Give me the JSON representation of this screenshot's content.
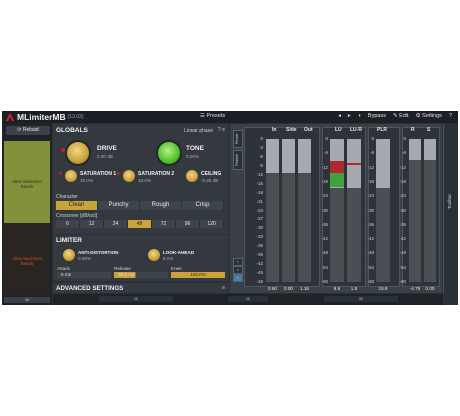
{
  "app": {
    "name": "MLimiterMB",
    "version": "(13.03)",
    "presets_label": "Presets",
    "bypass_label": "Bypass",
    "edit_label": "Edit",
    "settings_label": "Settings",
    "colors": {
      "accent": "#c9a23a",
      "bg": "#2a3037",
      "titlebar": "#1c2025",
      "gain_reduction": "#82913a"
    }
  },
  "left": {
    "reload_label": "Reload",
    "gr_text": "Ultra-maximizer\nBands",
    "limiter_text": "Ultra-maximizer\nBands",
    "footer_label": "III"
  },
  "globals": {
    "title": "GLOBALS",
    "mode": "Linear phase",
    "drive": {
      "label": "DRIVE",
      "value": "2.00 dB"
    },
    "tone": {
      "label": "TONE",
      "value": "0.00%"
    },
    "saturation1": {
      "label": "SATURATION 1",
      "value": "10.0%"
    },
    "saturation2": {
      "label": "SATURATION 2",
      "value": "10.0%"
    },
    "ceiling": {
      "label": "CEILING",
      "value": "-0.25 dB"
    },
    "character_label": "Character",
    "characters": [
      "Clean",
      "Punchy",
      "Rough",
      "Crisp"
    ],
    "character_selected": "Clean",
    "crossover_label": "Crossover [dB/oct]",
    "crossovers": [
      "6",
      "12",
      "24",
      "48",
      "72",
      "96",
      "120"
    ],
    "crossover_selected": "48"
  },
  "limiter": {
    "title": "LIMITER",
    "anti_distortion": {
      "label": "ANTI-DISTORTION",
      "value": "0.00%"
    },
    "look_ahead": {
      "label": "LOOK-AHEAD",
      "value": "6 ms"
    },
    "attack": {
      "label": "Attack",
      "value": "0 ms"
    },
    "release": {
      "label": "Release",
      "value": "50.0 ms"
    },
    "knee": {
      "label": "Knee",
      "value": "100.0%"
    }
  },
  "advanced": {
    "title": "ADVANCED SETTINGS"
  },
  "meters": {
    "side_buttons": [
      "Reset",
      "Flatten"
    ],
    "headers": [
      "In",
      "Side",
      "Out",
      "LU",
      "LU-R",
      "PLR",
      "R",
      "S"
    ],
    "scale": [
      "0",
      "-3",
      "-6",
      "-9",
      "-12",
      "-15",
      "-18",
      "-21",
      "-24",
      "-27",
      "-30",
      "-33",
      "-36",
      "-39",
      "-42",
      "-45",
      "-48"
    ],
    "lu_scale": [
      "0",
      "-6",
      "-12",
      "-18",
      "-24",
      "-30",
      "-36",
      "-42",
      "-48",
      "-54",
      "-60"
    ],
    "values": {
      "in": "0.60",
      "side": "0.00",
      "out": "1.16",
      "lu": "6.5",
      "lur": "1.8",
      "plr": "15.9",
      "r": "-4.79",
      "s": "0.00"
    },
    "levels": {
      "in": 0.76,
      "side": 0.76,
      "out": 0.76,
      "lu": 0.66,
      "lur": 0.66,
      "plr": 0.66,
      "r": 0.85,
      "s": 0.85
    },
    "footer": "III"
  },
  "toolbar": {
    "label": "Toolbar"
  }
}
